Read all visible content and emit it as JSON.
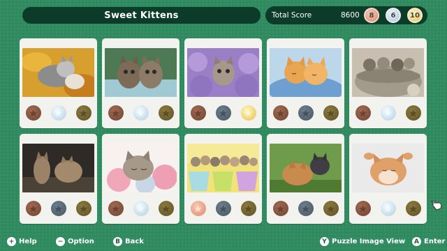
{
  "header": {
    "title": "Sweet Kittens"
  },
  "score": {
    "label": "Total Score",
    "value": "8600",
    "medal_counts": {
      "bronze": "8",
      "silver": "6",
      "gold": "10"
    }
  },
  "puzzles": [
    {
      "scene": "kittens-on-autumn-leaves",
      "medals": [
        true,
        true,
        true
      ]
    },
    {
      "scene": "two-tabby-kittens-in-basket",
      "medals": [
        true,
        true,
        true
      ]
    },
    {
      "scene": "kitten-in-lilac-flowers",
      "medals": [
        true,
        false,
        true
      ]
    },
    {
      "scene": "orange-kittens-in-blue-blanket",
      "medals": [
        true,
        false,
        true
      ]
    },
    {
      "scene": "kittens-in-knitted-basket",
      "medals": [
        true,
        true,
        true
      ]
    },
    {
      "scene": "two-kittens-boxing",
      "medals": [
        true,
        false,
        true
      ]
    },
    {
      "scene": "sleeping-kitten-with-yarn",
      "medals": [
        true,
        true,
        true
      ]
    },
    {
      "scene": "kittens-in-colorful-pots",
      "medals": [
        true,
        false,
        true
      ]
    },
    {
      "scene": "kittens-on-green-grass",
      "medals": [
        true,
        true,
        true
      ]
    },
    {
      "scene": "stretching-ginger-kitten",
      "medals": [
        true,
        true,
        true
      ]
    }
  ],
  "footer": {
    "help": "Help",
    "option": "Option",
    "back": "Back",
    "view": "Puzzle Image View",
    "enter": "Enter"
  },
  "colors": {
    "background": "#2f8a60",
    "bar": "#0d3b2a",
    "card": "#f2f2ee"
  }
}
